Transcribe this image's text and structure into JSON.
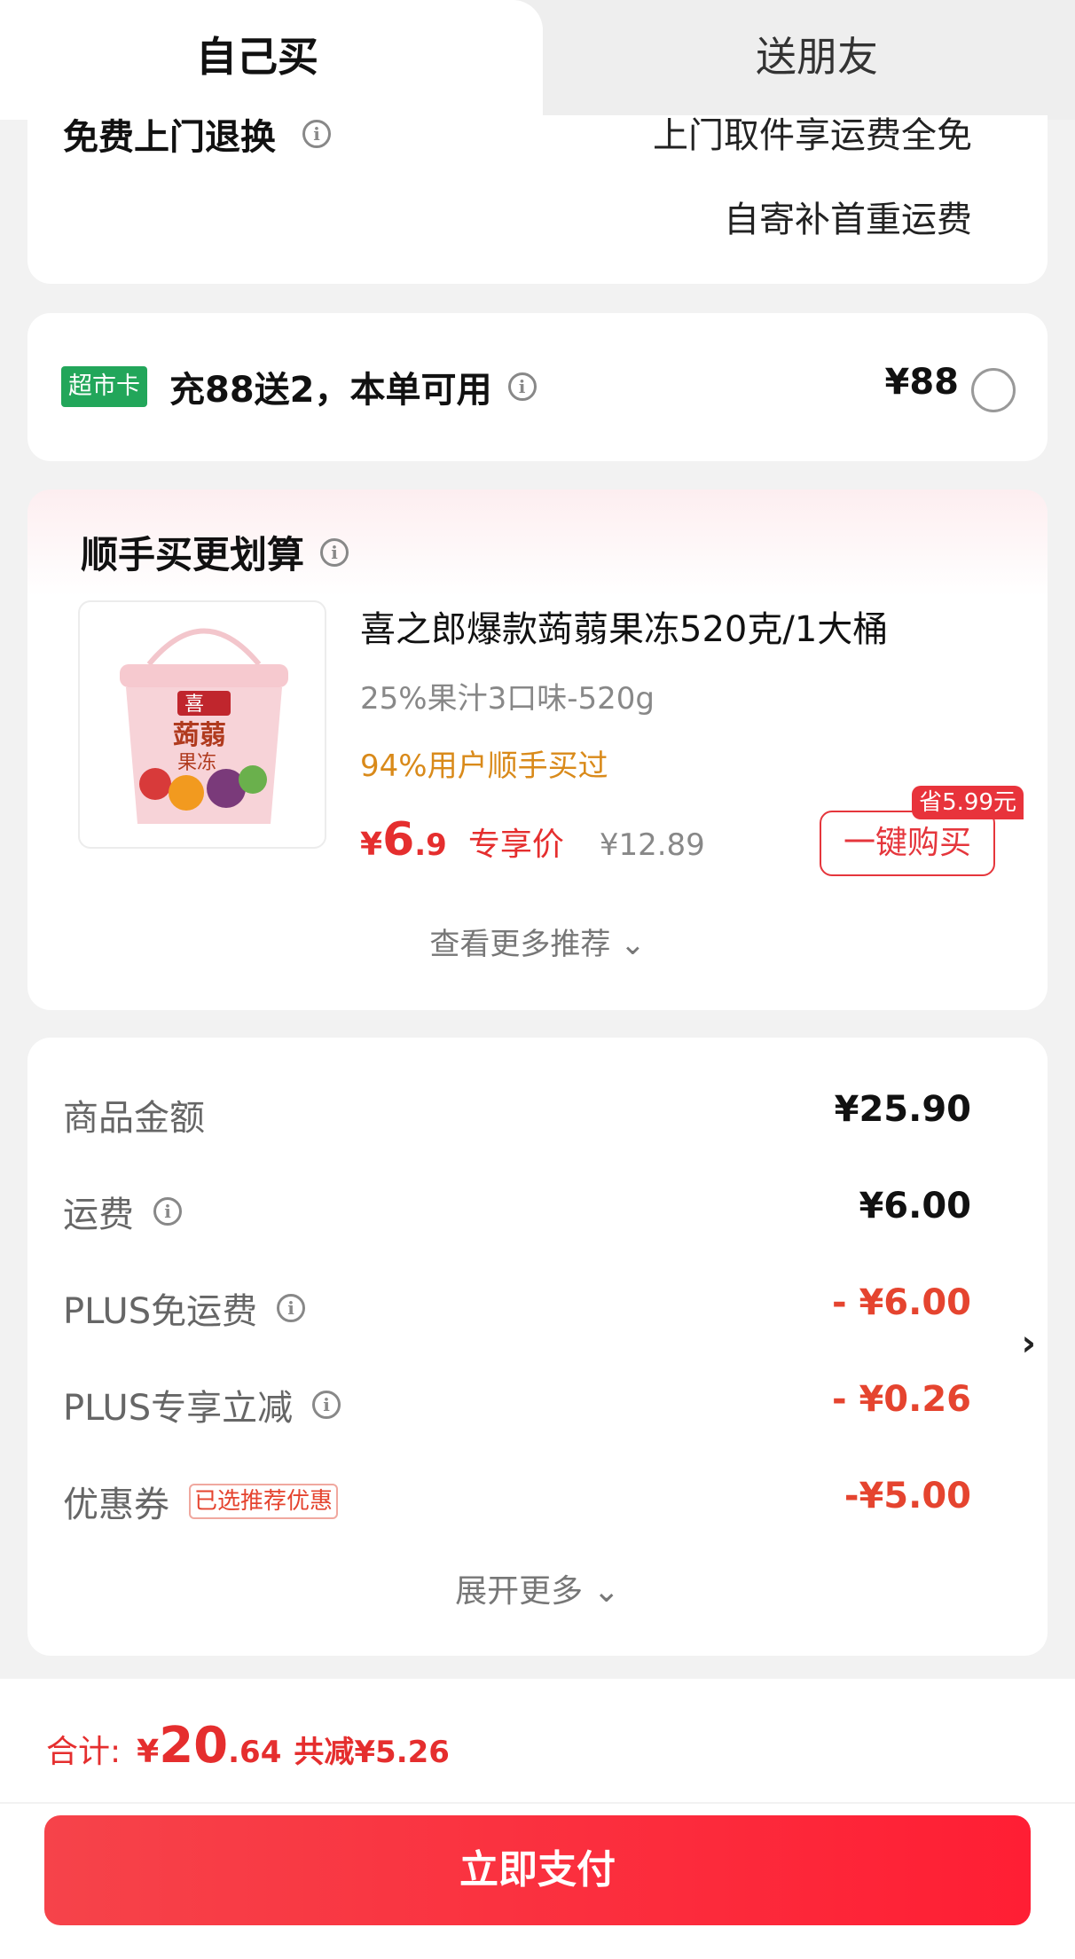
{
  "tabs": {
    "active": "自己买",
    "inactive": "送朋友"
  },
  "return_policy": {
    "title": "免费上门退换",
    "line1": "上门取件享运费全免",
    "line2": "自寄补首重运费"
  },
  "market_card": {
    "badge": "超市卡",
    "text": "充88送2，本单可用",
    "price": "¥88"
  },
  "recommendation": {
    "title": "顺手买更划算",
    "product": {
      "name": "喜之郎爆款蒟蒻果冻520克/1大桶",
      "spec": "25%果汁3口味-520g",
      "social": "94%用户顺手买过",
      "price_symbol": "¥",
      "price_int": "6",
      "price_dec": ".9",
      "price_tag": "专享价",
      "original_price": "¥12.89",
      "save_badge": "省5.99元",
      "buy_button": "一键购买",
      "image_text_brand": "喜",
      "image_text_name": "蒟蒻",
      "image_text_sub": "果冻"
    },
    "more_label": "查看更多推荐"
  },
  "summary": {
    "rows": [
      {
        "label": "商品金额",
        "value": "¥25.90"
      },
      {
        "label": "运费",
        "value": "¥6.00"
      },
      {
        "label": "PLUS免运费",
        "value": "- ¥6.00"
      },
      {
        "label": "PLUS专享立减",
        "value": "- ¥0.26"
      },
      {
        "label": "优惠券",
        "tag": "已选推荐优惠",
        "value": "-¥5.00"
      }
    ],
    "more_label": "展开更多"
  },
  "bottom": {
    "total_label": "合计:",
    "total_symbol": "¥",
    "total_int": "20",
    "total_dec": ".64",
    "saved": "共减¥5.26",
    "pay_button": "立即支付"
  },
  "colors": {
    "accent_red": "#e52e2e",
    "market_green": "#22a65a",
    "social_orange": "#d98a1a"
  }
}
